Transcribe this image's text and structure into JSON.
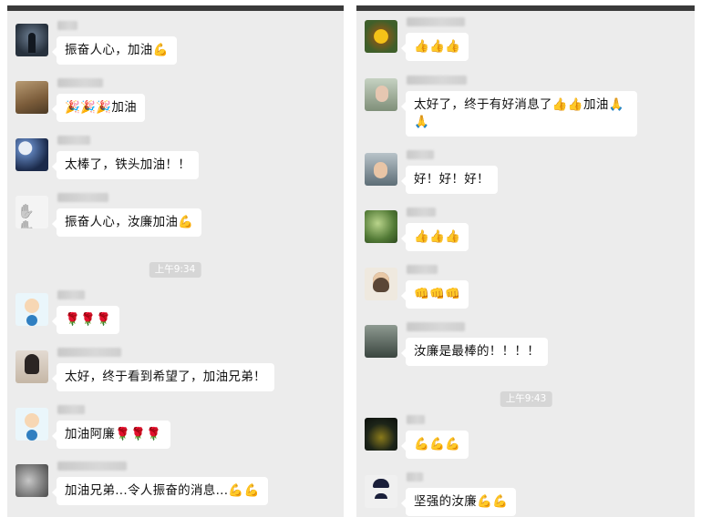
{
  "left_panel": {
    "time_stamp": "上午9:34",
    "messages": [
      {
        "text": "振奋人心，加油💪"
      },
      {
        "text": "🎉🎉🎉加油"
      },
      {
        "text": "太棒了，铁头加油！！"
      },
      {
        "text": "振奋人心，汝廉加油💪"
      },
      {
        "text": "🌹🌹🌹"
      },
      {
        "text": "太好，终于看到希望了，加油兄弟！"
      },
      {
        "text": "加油阿廉🌹🌹🌹"
      },
      {
        "text": "加油兄弟...令人振奋的消息...💪💪"
      }
    ]
  },
  "right_panel": {
    "time_stamp": "上午9:43",
    "messages": [
      {
        "text": "👍👍👍"
      },
      {
        "text": "太好了，终于有好消息了👍👍加油🙏🙏"
      },
      {
        "text": "好！好！好！"
      },
      {
        "text": "👍👍👍"
      },
      {
        "text": "👊👊👊"
      },
      {
        "text": "汝廉是最棒的！！！！"
      },
      {
        "text": "💪💪💪"
      },
      {
        "text": "坚强的汝廉💪💪"
      }
    ]
  }
}
